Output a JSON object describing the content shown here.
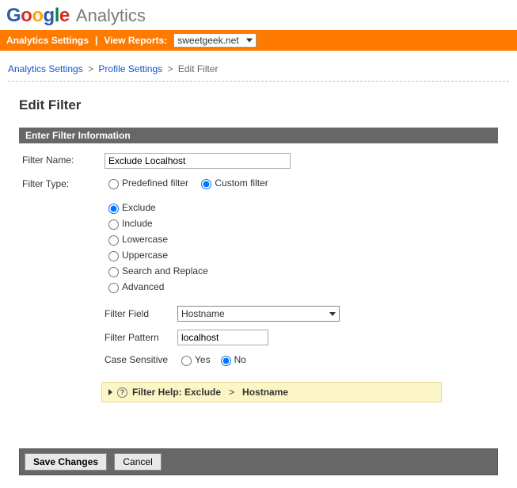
{
  "logo": {
    "google": "Google",
    "analytics": "Analytics"
  },
  "topbar": {
    "analytics_settings": "Analytics Settings",
    "view_reports": "View Reports:",
    "site": "sweetgeek.net"
  },
  "breadcrumb": {
    "a": "Analytics Settings",
    "b": "Profile Settings",
    "c": "Edit Filter",
    "sep": ">"
  },
  "page_title": "Edit Filter",
  "section_header": "Enter Filter Information",
  "form": {
    "filter_name_label": "Filter Name:",
    "filter_name_value": "Exclude Localhost",
    "filter_type_label": "Filter Type:",
    "predefined": "Predefined filter",
    "custom": "Custom filter",
    "opts": {
      "exclude": "Exclude",
      "include": "Include",
      "lowercase": "Lowercase",
      "uppercase": "Uppercase",
      "search_replace": "Search and Replace",
      "advanced": "Advanced"
    },
    "filter_field_label": "Filter Field",
    "filter_field_value": "Hostname",
    "filter_pattern_label": "Filter Pattern",
    "filter_pattern_value": "localhost",
    "case_sensitive_label": "Case Sensitive",
    "yes": "Yes",
    "no": "No"
  },
  "help": {
    "prefix": "Filter Help: Exclude",
    "arrow": ">",
    "suffix": "Hostname"
  },
  "buttons": {
    "save": "Save Changes",
    "cancel": "Cancel"
  }
}
